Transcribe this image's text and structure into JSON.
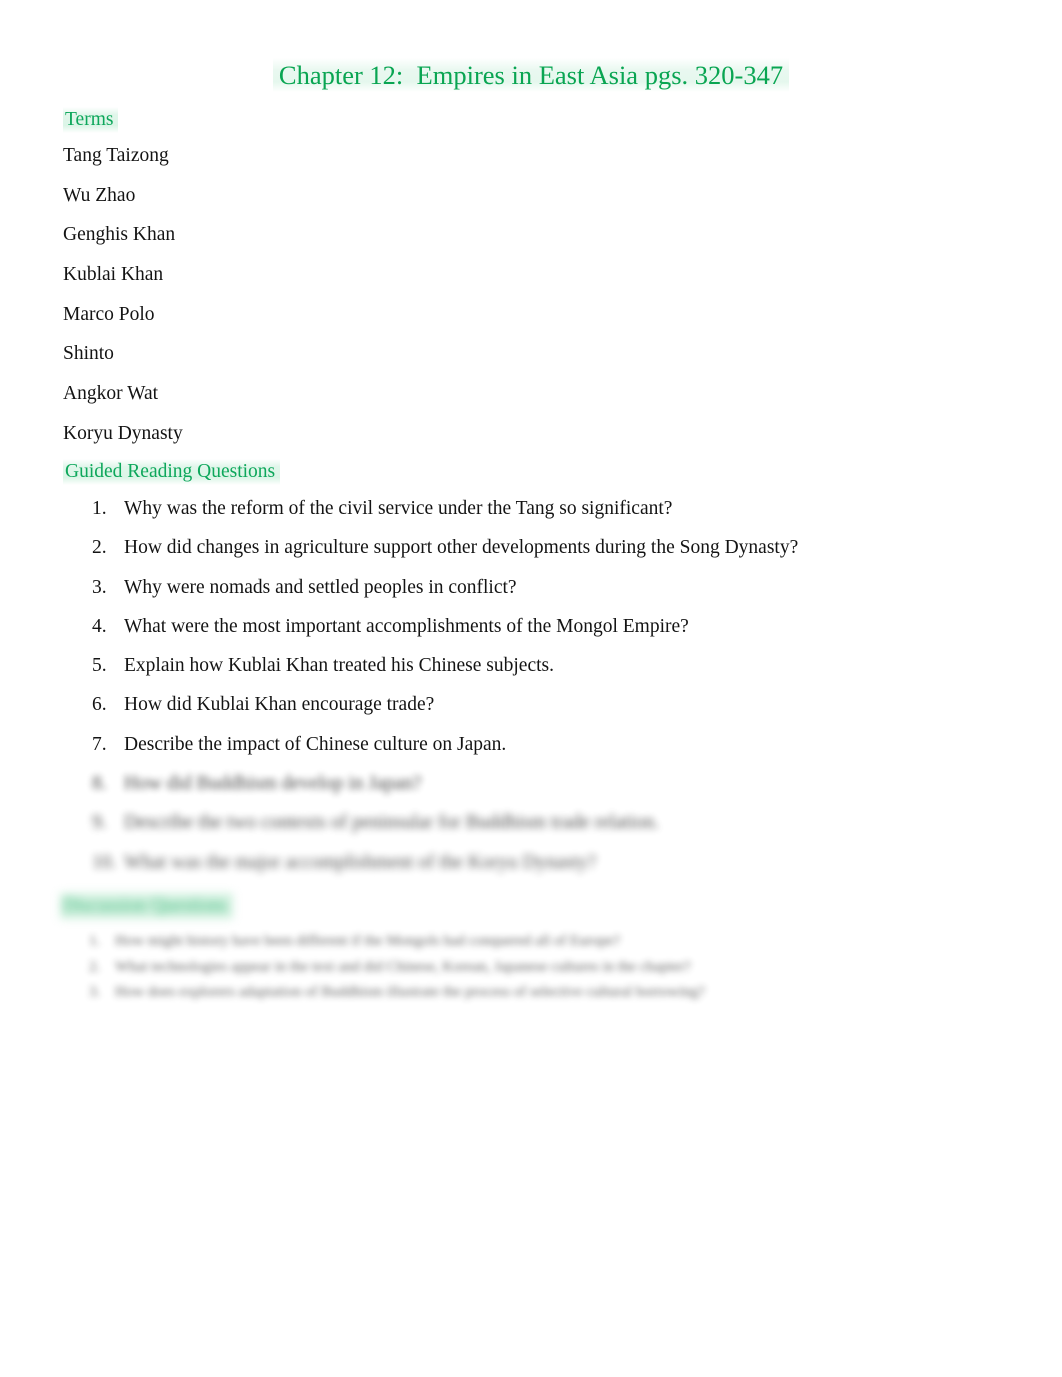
{
  "document": {
    "title": "Chapter 12:  Empires in East Asia pgs. 320-347",
    "accent_color": "#09A552",
    "heading_color": "#0DA75B",
    "highlight_color": "#D3F2E1",
    "body_color": "#141414",
    "background_color": "#FFFFFF"
  },
  "sections": {
    "terms": {
      "heading": "Terms",
      "items": [
        "Tang Taizong",
        "Wu Zhao",
        "Genghis Khan",
        "Kublai Khan",
        "Marco Polo",
        "Shinto",
        "Angkor Wat",
        "Koryu Dynasty"
      ]
    },
    "guided_reading": {
      "heading": "Guided Reading Questions",
      "questions": [
        {
          "number": "1.",
          "text": "Why was the reform of the civil service under the Tang so significant?"
        },
        {
          "number": "2.",
          "text": "How did changes in agriculture support other developments during the Song Dynasty?"
        },
        {
          "number": "3.",
          "text": "Why were nomads and settled peoples in conflict?"
        },
        {
          "number": "4.",
          "text": "What were the most important accomplishments of the Mongol Empire?"
        },
        {
          "number": "5.",
          "text": "Explain how Kublai Khan treated his Chinese subjects."
        },
        {
          "number": "6.",
          "text": "How did Kublai Khan encourage trade?"
        },
        {
          "number": "7.",
          "text": "Describe the impact of Chinese culture on Japan."
        },
        {
          "number": "8.",
          "text": "How did Buddhism develop in Japan?"
        },
        {
          "number": "9.",
          "text": "Describe the two contexts of peninsular for Buddhism trade relation."
        },
        {
          "number": "10.",
          "text": "What was the major accomplishment of the Koryu Dynasty?"
        }
      ]
    },
    "discussion": {
      "heading": "Discussion Questions",
      "items": [
        {
          "number": "1.",
          "text": "How might history have been different if the Mongols had conquered all of Europe?"
        },
        {
          "number": "2.",
          "text": "What technologies appear in the text and did Chinese, Korean, Japanese cultures in the chapter?"
        },
        {
          "number": "3.",
          "text": "How does explorers adaptation of Buddhism illustrate the process of selective cultural borrowing?"
        }
      ]
    }
  }
}
